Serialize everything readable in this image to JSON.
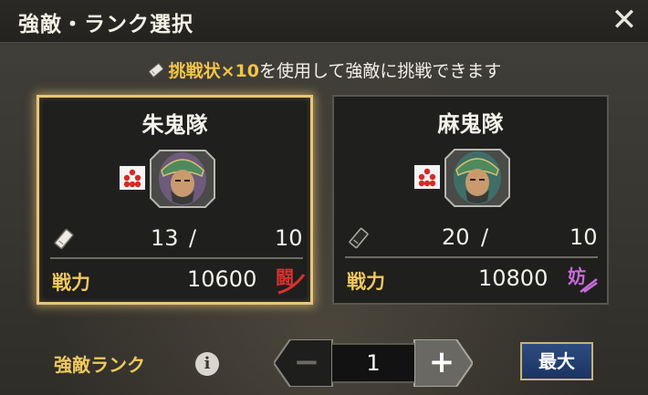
{
  "dialog": {
    "title": "強敵・ランク選択",
    "close_label": "✕"
  },
  "notice": {
    "item": "挑戦状×10",
    "text": "を使用して強敵に挑戦できます"
  },
  "cards": [
    {
      "name": "朱鬼隊",
      "current": "13",
      "separator": "/",
      "required": "10",
      "power_label": "戦力",
      "power": "10600",
      "type_icon": "闘",
      "selected": true
    },
    {
      "name": "麻鬼隊",
      "current": "20",
      "separator": "/",
      "required": "10",
      "power_label": "戦力",
      "power": "10800",
      "type_icon": "妨",
      "selected": false
    }
  ],
  "rank": {
    "label": "強敵ランク",
    "info_label": "i",
    "value": "1",
    "minus_label": "−",
    "plus_label": "+",
    "max_label": "最大"
  },
  "colors": {
    "gold": "#f0c95e",
    "selected_border": "#e8c677",
    "attack_red": "#d8322e",
    "disrupt_purple": "#c86ad8"
  }
}
